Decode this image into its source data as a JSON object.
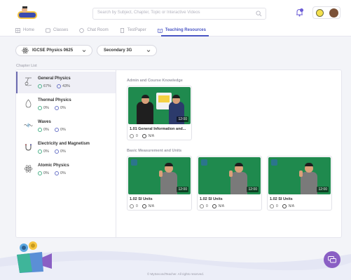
{
  "header": {
    "search_placeholder": "Search by Subject, Chapter, Topic or Interactive Videos",
    "nav": [
      {
        "label": "Home",
        "icon": "home-icon"
      },
      {
        "label": "Classes",
        "icon": "classes-icon"
      },
      {
        "label": "Chat Room",
        "icon": "chat-icon"
      },
      {
        "label": "TestPaper",
        "icon": "testpaper-icon"
      },
      {
        "label": "Teaching Resources",
        "icon": "book-icon",
        "active": true
      }
    ]
  },
  "filters": {
    "subject": "IGCSE Physics 0625",
    "class": "Secondary 3G"
  },
  "chapter_list_heading": "Chapter List",
  "chapters": [
    {
      "title": "General Physics",
      "completed": "67%",
      "watched": "43%",
      "active": true,
      "icon": "pendulum-icon"
    },
    {
      "title": "Thermal Physics",
      "completed": "0%",
      "watched": "0%",
      "icon": "flame-icon"
    },
    {
      "title": "Waves",
      "completed": "0%",
      "watched": "0%",
      "icon": "wave-icon"
    },
    {
      "title": "Electricity and Magnetism",
      "completed": "0%",
      "watched": "0%",
      "icon": "magnet-icon"
    },
    {
      "title": "Atomic Physics",
      "completed": "0%",
      "watched": "0%",
      "icon": "atom-icon"
    }
  ],
  "sections": [
    {
      "title": "Admin and Course Knowledge",
      "videos": [
        {
          "title": "1.01 General Information and...",
          "duration": "12:00",
          "views": "0",
          "rating": "N/A"
        }
      ]
    },
    {
      "title": "Basic Measurement and Units",
      "videos": [
        {
          "title": "1.02 SI Units",
          "duration": "12:00",
          "views": "0",
          "rating": "N/A"
        },
        {
          "title": "1.02 SI Units",
          "duration": "12:00",
          "views": "0",
          "rating": "N/A"
        },
        {
          "title": "1.02 SI Units",
          "duration": "12:00",
          "views": "0",
          "rating": "N/A"
        }
      ]
    }
  ],
  "footer": "© MySecondTeacher. All rights reserved.",
  "colors": {
    "accent": "#4a56c4",
    "chat": "#8a5fc4",
    "thumb": "#1f8a4e"
  }
}
